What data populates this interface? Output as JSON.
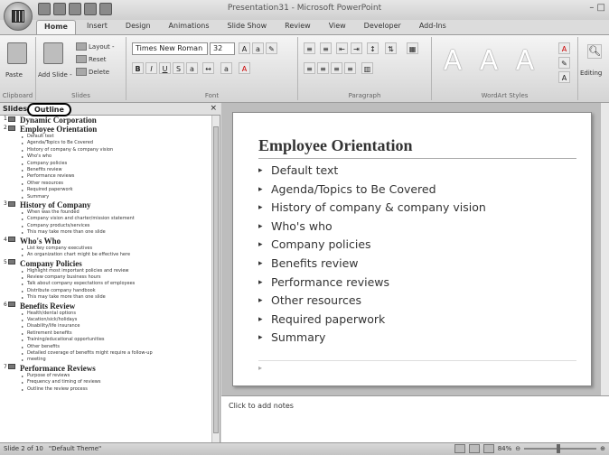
{
  "window": {
    "title": "Presentation31 - Microsoft PowerPoint"
  },
  "tabs": [
    "Home",
    "Insert",
    "Design",
    "Animations",
    "Slide Show",
    "Review",
    "View",
    "Developer",
    "Add-Ins"
  ],
  "ribbon": {
    "paste": "Paste",
    "add_slide": "Add Slide -",
    "layout": "Layout -",
    "reset": "Reset",
    "delete": "Delete",
    "font_name": "Times New Roman",
    "font_size": "32",
    "editing": "Editing",
    "groups": {
      "clipboard": "Clipboard",
      "slides": "Slides",
      "font": "Font",
      "paragraph": "Paragraph",
      "wordart": "WordArt Styles"
    },
    "wordart_letter": "A"
  },
  "left_pane": {
    "tab_slides": "Slides",
    "tab_outline": "Outline",
    "close": "×",
    "slides": [
      {
        "num": "1",
        "title": "Dynamic Corporation",
        "bullets": []
      },
      {
        "num": "2",
        "title": "Employee Orientation",
        "bullets": [
          "Default text",
          "Agenda/Topics to Be Covered",
          "History of company & company vision",
          "Who's who",
          "Company policies",
          "Benefits review",
          "Performance reviews",
          "Other resources",
          "Required paperwork",
          "Summary"
        ]
      },
      {
        "num": "3",
        "title": "History of Company",
        "bullets": [
          "When was the founded",
          "Company vision and charter/mission statement",
          "Company products/services",
          "This may take more than one slide"
        ]
      },
      {
        "num": "4",
        "title": "Who's Who",
        "bullets": [
          "List key company executives",
          "An organization chart might be effective here"
        ]
      },
      {
        "num": "5",
        "title": "Company Policies",
        "bullets": [
          "Highlight most important policies and review",
          "Review company business hours",
          "Talk about company expectations of employees",
          "Distribute company handbook",
          "This may take more than one slide"
        ]
      },
      {
        "num": "6",
        "title": "Benefits Review",
        "bullets": [
          "Health/dental options",
          "Vacation/sick/holidays",
          "Disability/life insurance",
          "Retirement benefits",
          "Training/educational opportunities",
          "Other benefits",
          "Detailed coverage of benefits might require a follow-up",
          "meeting"
        ]
      },
      {
        "num": "7",
        "title": "Performance Reviews",
        "bullets": [
          "Purpose of reviews",
          "Frequency and timing of reviews",
          "Outline the review process"
        ]
      }
    ]
  },
  "slide": {
    "title": "Employee Orientation",
    "bullets": [
      "Default text",
      "Agenda/Topics to Be Covered",
      "History of company & company vision",
      "Who's who",
      "Company policies",
      "Benefits review",
      "Performance reviews",
      "Other resources",
      "Required paperwork",
      "Summary"
    ]
  },
  "notes": {
    "placeholder": "Click to add notes"
  },
  "status": {
    "slide": "Slide 2 of 10",
    "theme": "\"Default Theme\"",
    "zoom": "84%"
  }
}
